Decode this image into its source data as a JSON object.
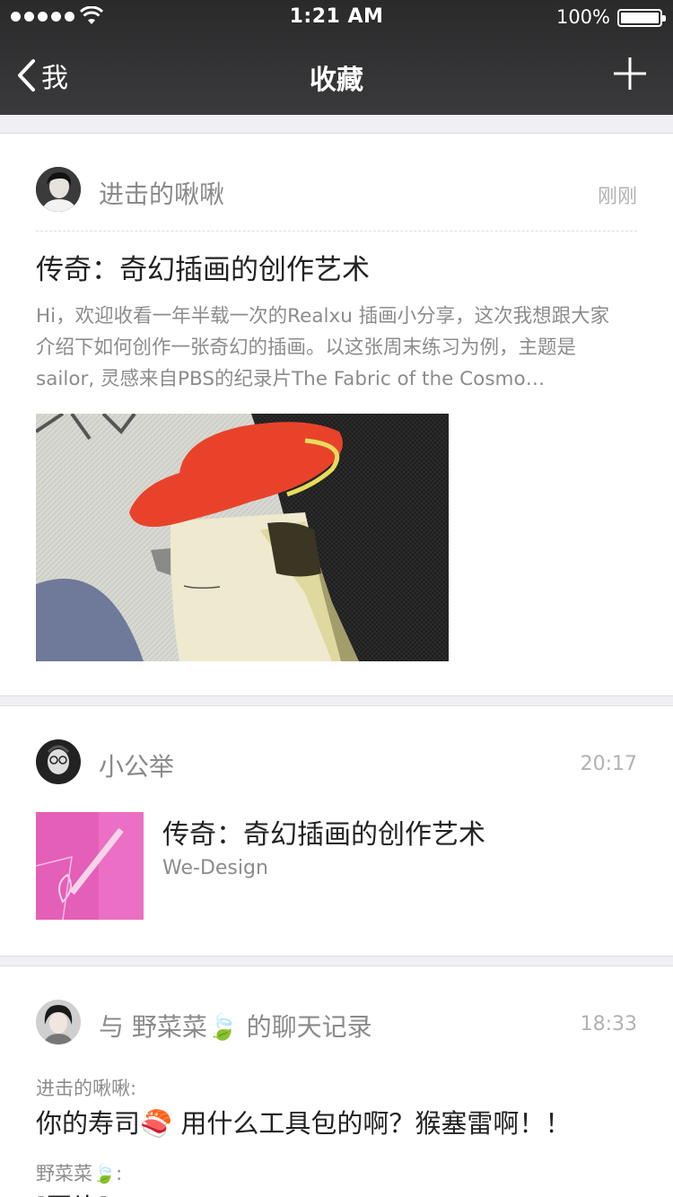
{
  "status_bar": {
    "time": "1:21 AM",
    "battery": "100%"
  },
  "nav": {
    "back_label": "我",
    "title": "收藏"
  },
  "favorites": [
    {
      "author": "进击的啾啾",
      "time": "刚刚",
      "title": "传奇：奇幻插画的创作艺术",
      "summary": "Hi，欢迎收看一年半载一次的Realxu 插画小分享，这次我想跟大家介绍下如何创作一张奇幻的插画。以这张周末练习为例，主题是sailor, 灵感来自PBS的纪录片The Fabric of the Cosmo…"
    },
    {
      "author": "小公举",
      "time": "20:17",
      "title": "传奇：奇幻插画的创作艺术",
      "source": "We-Design"
    },
    {
      "author": "与 野菜菜🍃 的聊天记录",
      "time": "18:33",
      "messages": [
        {
          "sender": "进击的啾啾:",
          "text": "你的寿司🍣 用什么工具包的啊？猴塞雷啊！！"
        },
        {
          "sender": "野菜菜🍃:",
          "text": "[图片]"
        }
      ]
    }
  ],
  "colors": {
    "navbar_bg": "#333334",
    "page_bg": "#efeff4",
    "card_bg": "#ffffff",
    "hat_red": "#e8432a",
    "thumb_pink": "#e45fb8"
  },
  "icons": [
    "back-chevron-icon",
    "add-icon",
    "wifi-icon",
    "signal-icon",
    "battery-icon"
  ]
}
